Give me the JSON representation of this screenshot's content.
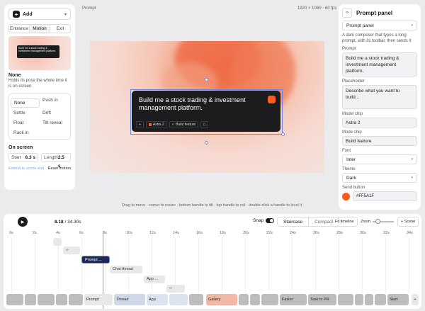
{
  "left": {
    "add_label": "Add",
    "tabs": [
      "Entrance",
      "Motion",
      "Exit"
    ],
    "active_tab": "Motion",
    "preview_text": "Build me a stock trading & investment management platform.",
    "selected_title": "None",
    "selected_desc": "Holds its pose the whole time it is on screen.",
    "options": [
      "None",
      "Push in",
      "Settle",
      "Drift",
      "Float",
      "Tilt reveal",
      "Rack in"
    ],
    "on_screen_label": "On screen",
    "start_label": "Start",
    "start_value": "6.3 s",
    "length_label": "Length",
    "length_value": "2.5 s",
    "extend_link": "Extend to scene end",
    "reset_link": "Reset motion"
  },
  "canvas": {
    "label": "Prompt",
    "resolution": "1920 × 1080 · 60 fps",
    "composer_text": "Build me a stock trading & investment management platform.",
    "chip_model": "Astra 2",
    "chip_mode": "Build feature",
    "hint": "Drag to move · corner to resize · bottom handle to tilt · top handle to roll · double-click a handle to level it"
  },
  "right": {
    "title": "Prompt panel",
    "type_value": "Prompt panel",
    "description": "A dark composer that types a long prompt, with its toolbar, then sends it",
    "prompt_label": "Prompt",
    "prompt_value": "Build me a stock trading & investment management platform.",
    "placeholder_label": "Placeholder",
    "placeholder_value": "Describe what you want to build...",
    "model_label": "Model chip",
    "model_value": "Astra 2",
    "mode_label": "Mode chip",
    "mode_value": "Build feature",
    "font_label": "Font",
    "font_value": "Inter",
    "theme_label": "Theme",
    "theme_value": "Dark",
    "send_label": "Send button",
    "send_color": "#FF5A1F"
  },
  "timeline": {
    "current": "8.18",
    "total": "/ 34.30s",
    "snap_label": "Snap",
    "mode_staircase": "Staircase",
    "mode_compact": "Compact",
    "fit_label": "Fit timeline",
    "zoom_label": "Zoom",
    "scene_label": "+ Scene",
    "ticks": [
      "0s",
      "2s",
      "4s",
      "6s",
      "8s",
      "10s",
      "12s",
      "14s",
      "16s",
      "18s",
      "20s",
      "22s",
      "24s",
      "26s",
      "28s",
      "30s",
      "32s",
      "34s"
    ],
    "clip_prompt": "Prompt ...",
    "clip_chat": "Chat thread",
    "clip_app": "App ...",
    "scenes": [
      "Prompt",
      "Thread",
      "App",
      "Gallery",
      "Faster",
      "Task to PR",
      "Start"
    ]
  }
}
